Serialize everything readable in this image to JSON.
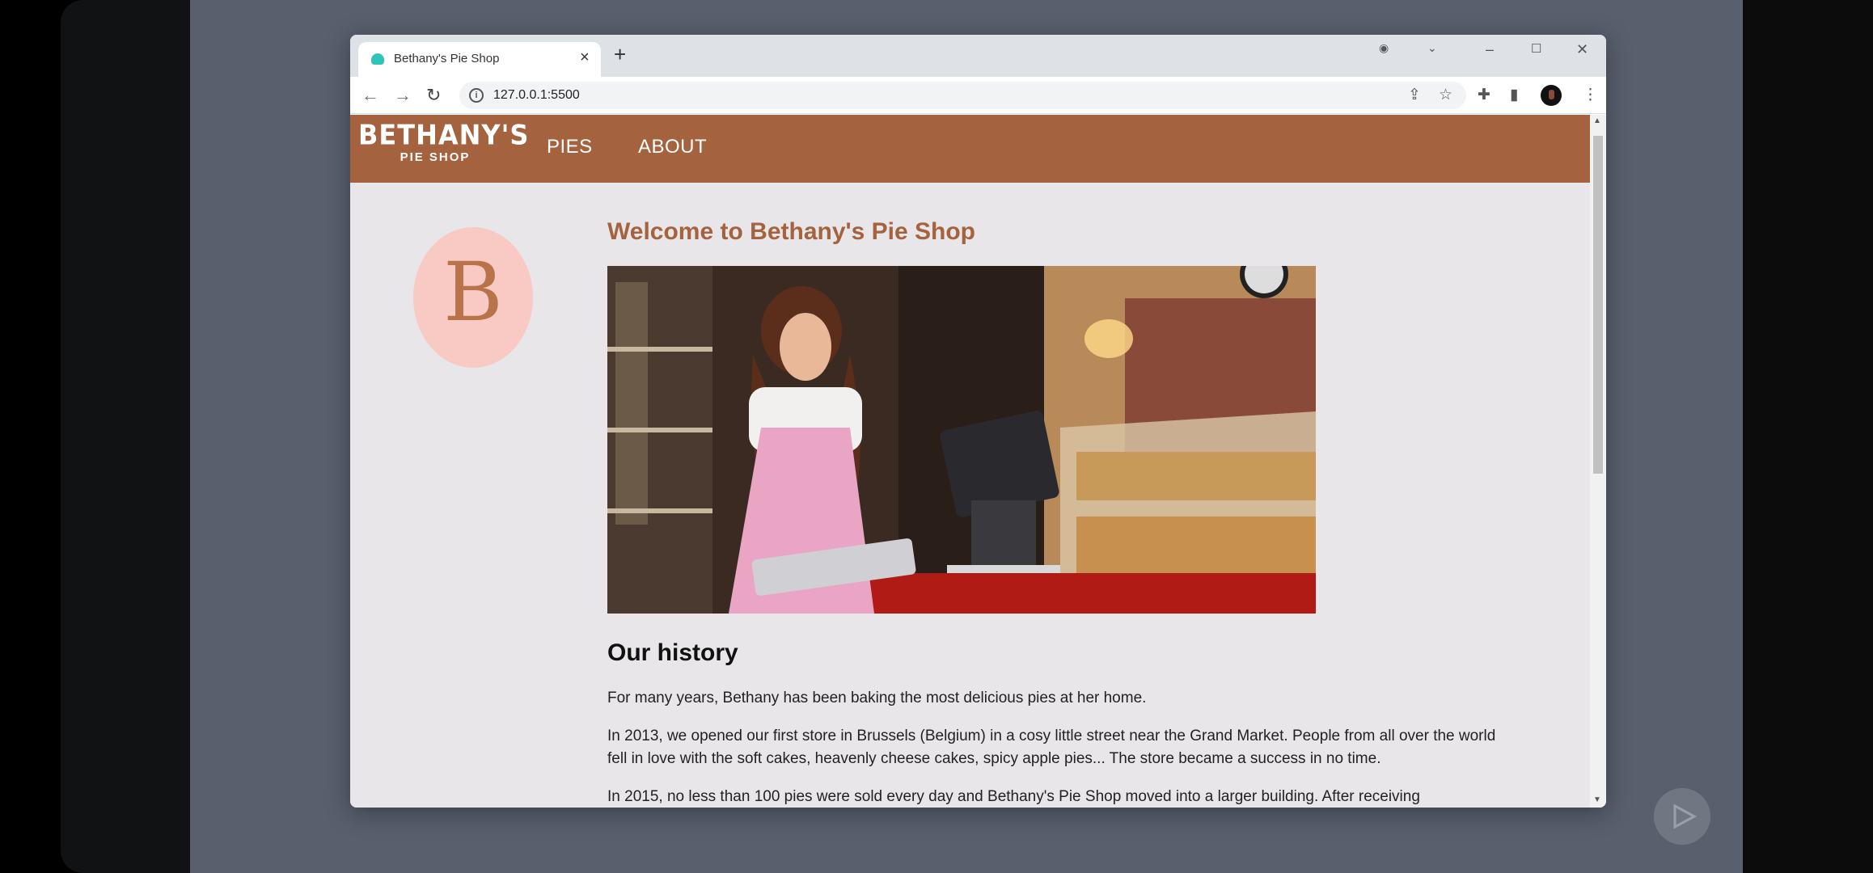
{
  "browser": {
    "tab_title": "Bethany's Pie Shop",
    "url": "127.0.0.1:5500"
  },
  "site": {
    "logo_main": "BETHANY'S",
    "logo_sub": "PIE SHOP",
    "nav": [
      "PIES",
      "ABOUT"
    ],
    "badge_letter": "B",
    "page_title": "Welcome to Bethany's Pie Shop",
    "history_title": "Our history",
    "paragraphs": [
      "For many years, Bethany has been baking the most delicious pies at her home.",
      "In 2013, we opened our first store in Brussels (Belgium) in a cosy little street near the Grand Market. People from all over the world fell in love with the soft cakes, heavenly cheese cakes, spicy apple pies... The store became a success in no time.",
      "In 2015, no less than 100 pies were sold every day and Bethany's Pie Shop moved into a larger building. After receiving"
    ]
  },
  "colors": {
    "brand": "#a5623f",
    "badge_bg": "#f9c9c3",
    "page_bg": "#e8e6e8"
  }
}
